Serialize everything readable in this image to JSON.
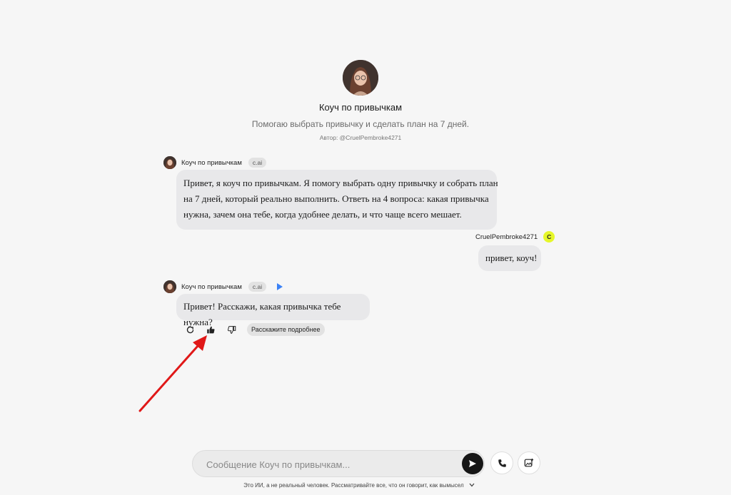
{
  "character": {
    "name": "Коуч по привычкам",
    "description": "Помогаю выбрать привычку и сделать план на 7 дней.",
    "author": "Автор: @CruelPembroke4271"
  },
  "messages": [
    {
      "sender": "Коуч по привычкам",
      "tag": "c.ai",
      "lines": [
        "Привет, я коуч по привычкам. Я помогу выбрать одну привычку и собрать план",
        "на 7 дней, который реально выполнить. Ответь на 4 вопроса: какая привычка",
        "нужна, зачем она тебе, когда удобнее делать, и что чаще всего мешает."
      ]
    },
    {
      "sender": "CruelPembroke4271",
      "avatar_letter": "C",
      "text": "привет, коуч!"
    },
    {
      "sender": "Коуч по привычкам",
      "tag": "c.ai",
      "text": "Привет! Расскажи, какая привычка тебе нужна?"
    }
  ],
  "actions": {
    "chip": "Расскажите подробнее",
    "icons": [
      "refresh-icon",
      "thumbs-up-icon",
      "thumbs-down-icon"
    ]
  },
  "composer": {
    "placeholder": "Сообщение Коуч по привычкам..."
  },
  "disclaimer": "Это ИИ, а не реальный человек. Рассматривайте все, что он говорит, как вымысел",
  "colors": {
    "user_avatar": "#e6f72a",
    "play_icon": "#3b82f6",
    "annotation_arrow": "#e01818"
  }
}
